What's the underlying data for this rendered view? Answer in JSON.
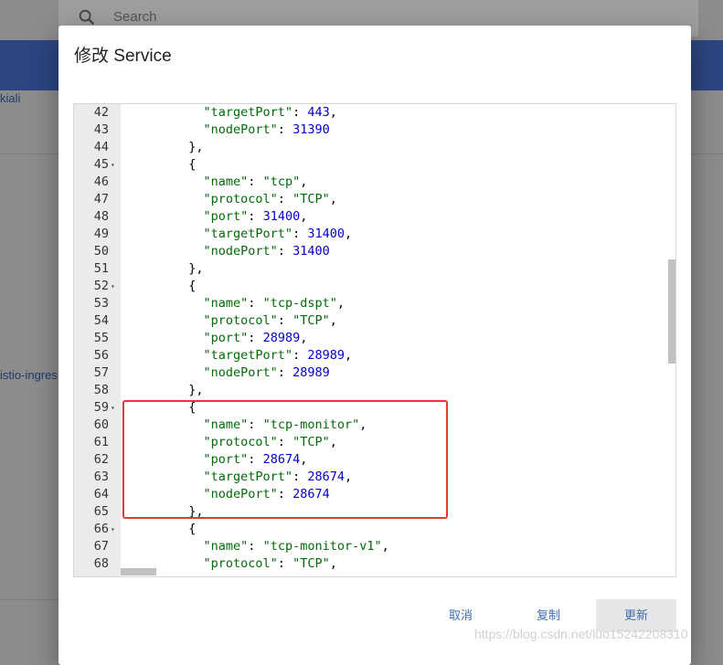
{
  "background": {
    "search_placeholder": "Search",
    "left_item_1": "kiali",
    "left_item_2": "istio-ingres"
  },
  "dialog": {
    "title": "修改 Service"
  },
  "editor": {
    "lines": [
      {
        "n": "42",
        "fold": false,
        "parts": [
          [
            "p",
            "    "
          ],
          [
            "k",
            "\"targetPort\""
          ],
          [
            "p",
            ": "
          ],
          [
            "n",
            "443"
          ],
          [
            "p",
            ","
          ]
        ]
      },
      {
        "n": "43",
        "fold": false,
        "parts": [
          [
            "p",
            "    "
          ],
          [
            "k",
            "\"nodePort\""
          ],
          [
            "p",
            ": "
          ],
          [
            "n",
            "31390"
          ]
        ]
      },
      {
        "n": "44",
        "fold": false,
        "parts": [
          [
            "p",
            "  },"
          ]
        ]
      },
      {
        "n": "45",
        "fold": true,
        "parts": [
          [
            "p",
            "  {"
          ]
        ]
      },
      {
        "n": "46",
        "fold": false,
        "parts": [
          [
            "p",
            "    "
          ],
          [
            "k",
            "\"name\""
          ],
          [
            "p",
            ": "
          ],
          [
            "s",
            "\"tcp\""
          ],
          [
            "p",
            ","
          ]
        ]
      },
      {
        "n": "47",
        "fold": false,
        "parts": [
          [
            "p",
            "    "
          ],
          [
            "k",
            "\"protocol\""
          ],
          [
            "p",
            ": "
          ],
          [
            "s",
            "\"TCP\""
          ],
          [
            "p",
            ","
          ]
        ]
      },
      {
        "n": "48",
        "fold": false,
        "parts": [
          [
            "p",
            "    "
          ],
          [
            "k",
            "\"port\""
          ],
          [
            "p",
            ": "
          ],
          [
            "n",
            "31400"
          ],
          [
            "p",
            ","
          ]
        ]
      },
      {
        "n": "49",
        "fold": false,
        "parts": [
          [
            "p",
            "    "
          ],
          [
            "k",
            "\"targetPort\""
          ],
          [
            "p",
            ": "
          ],
          [
            "n",
            "31400"
          ],
          [
            "p",
            ","
          ]
        ]
      },
      {
        "n": "50",
        "fold": false,
        "parts": [
          [
            "p",
            "    "
          ],
          [
            "k",
            "\"nodePort\""
          ],
          [
            "p",
            ": "
          ],
          [
            "n",
            "31400"
          ]
        ]
      },
      {
        "n": "51",
        "fold": false,
        "parts": [
          [
            "p",
            "  },"
          ]
        ]
      },
      {
        "n": "52",
        "fold": true,
        "parts": [
          [
            "p",
            "  {"
          ]
        ]
      },
      {
        "n": "53",
        "fold": false,
        "parts": [
          [
            "p",
            "    "
          ],
          [
            "k",
            "\"name\""
          ],
          [
            "p",
            ": "
          ],
          [
            "s",
            "\"tcp-dspt\""
          ],
          [
            "p",
            ","
          ]
        ]
      },
      {
        "n": "54",
        "fold": false,
        "parts": [
          [
            "p",
            "    "
          ],
          [
            "k",
            "\"protocol\""
          ],
          [
            "p",
            ": "
          ],
          [
            "s",
            "\"TCP\""
          ],
          [
            "p",
            ","
          ]
        ]
      },
      {
        "n": "55",
        "fold": false,
        "parts": [
          [
            "p",
            "    "
          ],
          [
            "k",
            "\"port\""
          ],
          [
            "p",
            ": "
          ],
          [
            "n",
            "28989"
          ],
          [
            "p",
            ","
          ]
        ]
      },
      {
        "n": "56",
        "fold": false,
        "parts": [
          [
            "p",
            "    "
          ],
          [
            "k",
            "\"targetPort\""
          ],
          [
            "p",
            ": "
          ],
          [
            "n",
            "28989"
          ],
          [
            "p",
            ","
          ]
        ]
      },
      {
        "n": "57",
        "fold": false,
        "parts": [
          [
            "p",
            "    "
          ],
          [
            "k",
            "\"nodePort\""
          ],
          [
            "p",
            ": "
          ],
          [
            "n",
            "28989"
          ]
        ]
      },
      {
        "n": "58",
        "fold": false,
        "parts": [
          [
            "p",
            "  },"
          ]
        ]
      },
      {
        "n": "59",
        "fold": true,
        "parts": [
          [
            "p",
            "  {"
          ]
        ]
      },
      {
        "n": "60",
        "fold": false,
        "parts": [
          [
            "p",
            "    "
          ],
          [
            "k",
            "\"name\""
          ],
          [
            "p",
            ": "
          ],
          [
            "s",
            "\"tcp-monitor\""
          ],
          [
            "p",
            ","
          ]
        ]
      },
      {
        "n": "61",
        "fold": false,
        "parts": [
          [
            "p",
            "    "
          ],
          [
            "k",
            "\"protocol\""
          ],
          [
            "p",
            ": "
          ],
          [
            "s",
            "\"TCP\""
          ],
          [
            "p",
            ","
          ]
        ]
      },
      {
        "n": "62",
        "fold": false,
        "parts": [
          [
            "p",
            "    "
          ],
          [
            "k",
            "\"port\""
          ],
          [
            "p",
            ": "
          ],
          [
            "n",
            "28674"
          ],
          [
            "p",
            ","
          ]
        ]
      },
      {
        "n": "63",
        "fold": false,
        "parts": [
          [
            "p",
            "    "
          ],
          [
            "k",
            "\"targetPort\""
          ],
          [
            "p",
            ": "
          ],
          [
            "n",
            "28674"
          ],
          [
            "p",
            ","
          ]
        ]
      },
      {
        "n": "64",
        "fold": false,
        "parts": [
          [
            "p",
            "    "
          ],
          [
            "k",
            "\"nodePort\""
          ],
          [
            "p",
            ": "
          ],
          [
            "n",
            "28674"
          ]
        ]
      },
      {
        "n": "65",
        "fold": false,
        "parts": [
          [
            "p",
            "  },"
          ]
        ]
      },
      {
        "n": "66",
        "fold": true,
        "parts": [
          [
            "p",
            "  {"
          ]
        ]
      },
      {
        "n": "67",
        "fold": false,
        "parts": [
          [
            "p",
            "    "
          ],
          [
            "k",
            "\"name\""
          ],
          [
            "p",
            ": "
          ],
          [
            "s",
            "\"tcp-monitor-v1\""
          ],
          [
            "p",
            ","
          ]
        ]
      },
      {
        "n": "68",
        "fold": false,
        "parts": [
          [
            "p",
            "    "
          ],
          [
            "k",
            "\"protocol\""
          ],
          [
            "p",
            ": "
          ],
          [
            "s",
            "\"TCP\""
          ],
          [
            "p",
            ","
          ]
        ]
      }
    ]
  },
  "actions": {
    "cancel_label": "取消",
    "copy_label": "复制",
    "update_label": "更新"
  },
  "watermark": "https://blog.csdn.net/luo15242208310",
  "colors": {
    "key": "#036a07",
    "number": "#0000cd",
    "highlight_border": "#e53935",
    "button_text": "#3f6db5"
  }
}
